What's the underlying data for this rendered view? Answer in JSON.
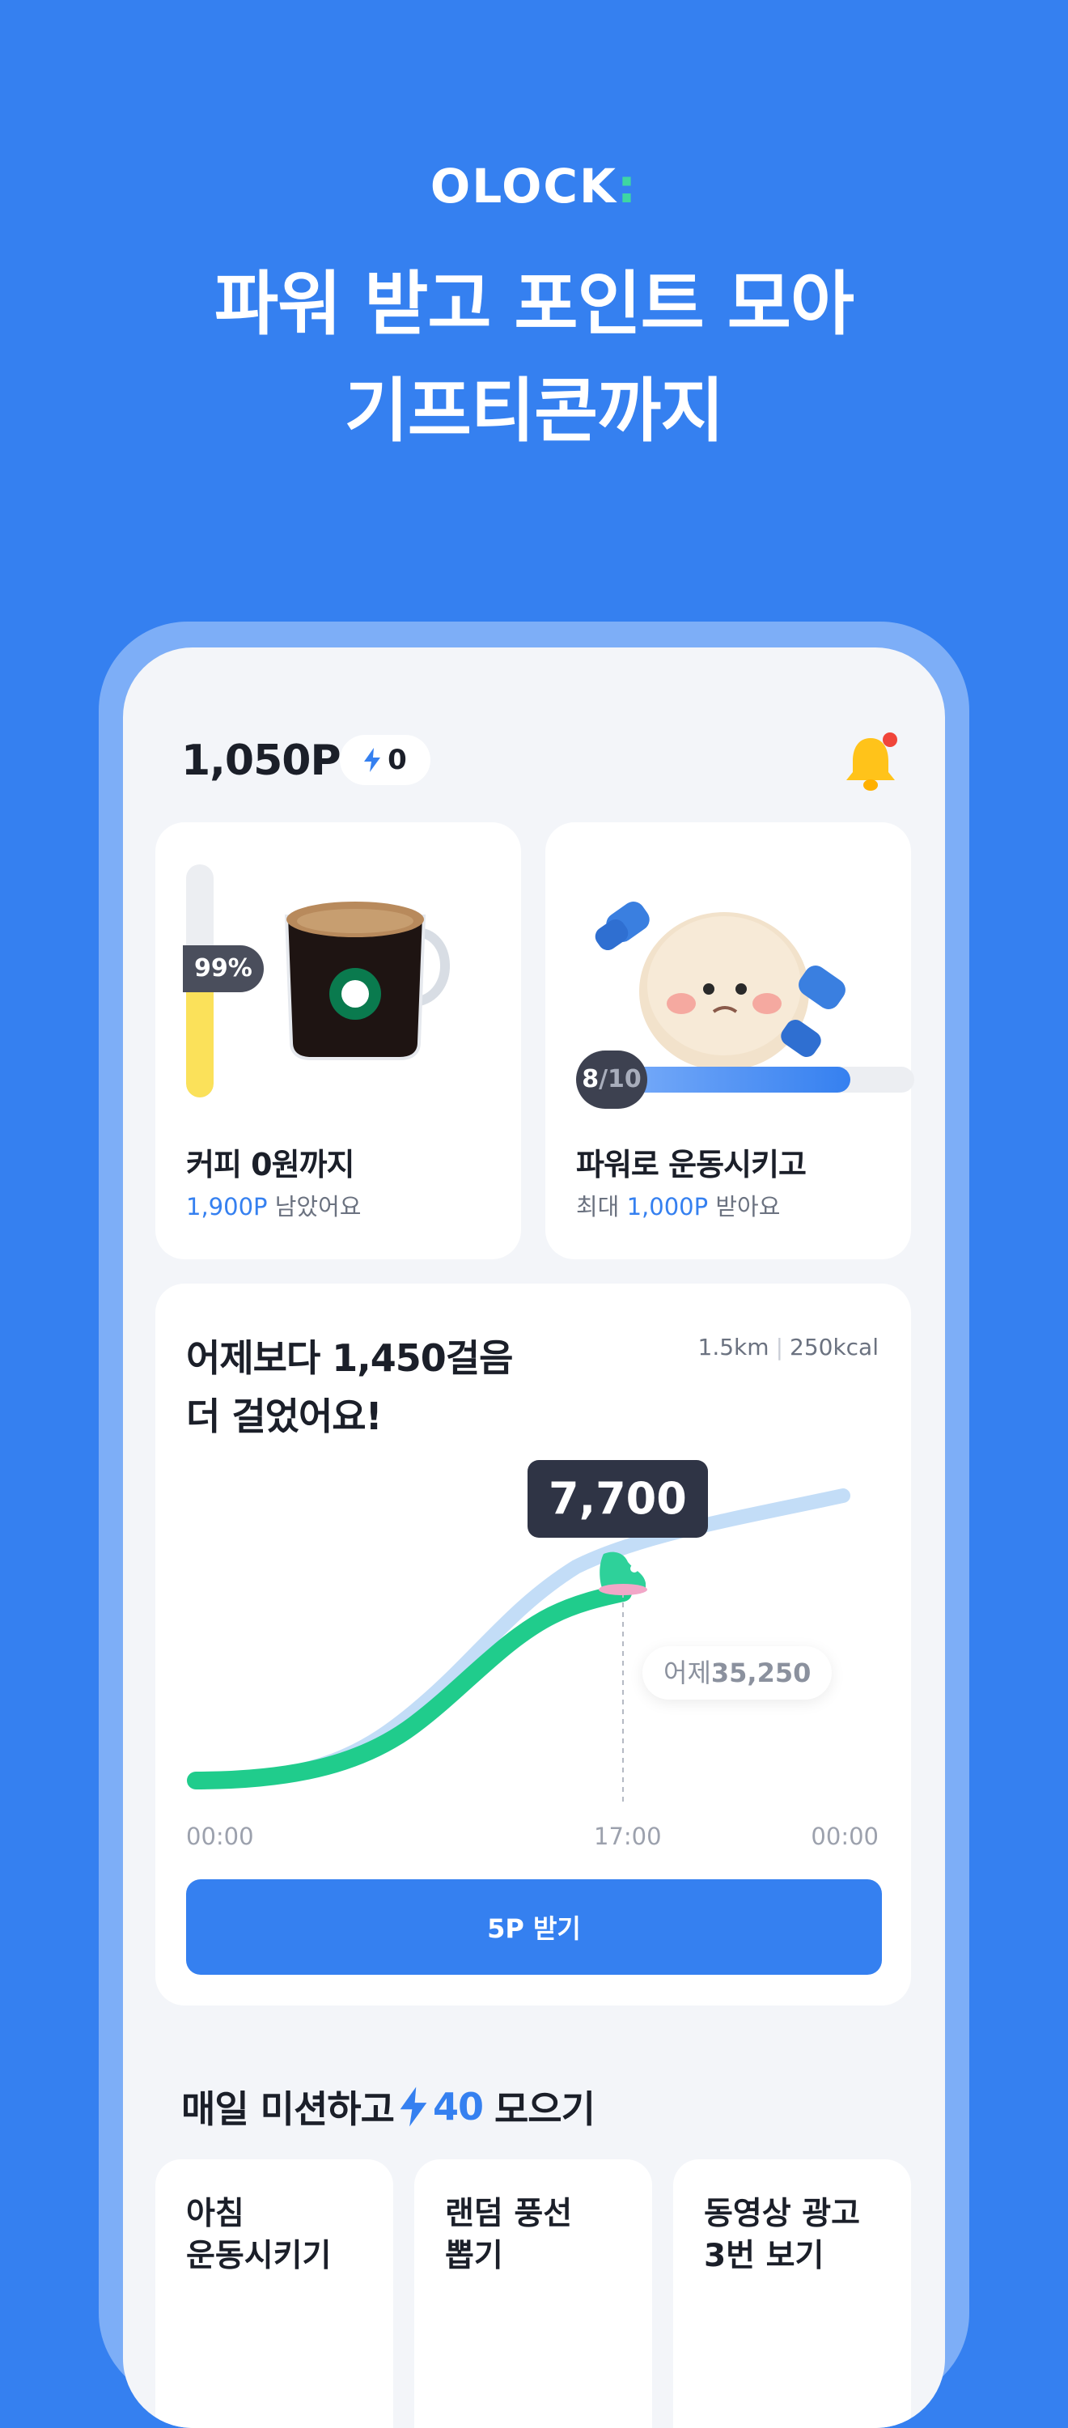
{
  "logo": {
    "text": "OLOCK",
    "mark": ":"
  },
  "headline": {
    "line1": "파워 받고 포인트 모아",
    "line2": "기프티콘까지"
  },
  "header": {
    "points": "1,050P",
    "power_count": "0"
  },
  "coffee_card": {
    "progress_percent": 99,
    "badge": "99%",
    "title": "커피 0원까지",
    "sub_value": "1,900P",
    "sub_rest": " 남았어요"
  },
  "exercise_card": {
    "done": "8",
    "total": "/10",
    "progress_fraction": 0.8,
    "title": "파워로 운동시키고",
    "sub_prefix": "최대 ",
    "sub_value": "1,000P",
    "sub_rest": " 받아요"
  },
  "steps_card": {
    "title_line1": "어제보다 1,450걸음",
    "title_line2": "더 걸었어요!",
    "distance": "1.5km",
    "calories": "250kcal",
    "current_steps": "7,700",
    "yesterday_label": "어제",
    "yesterday_steps": "35,250",
    "x_ticks": [
      "00:00",
      "17:00",
      "00:00"
    ],
    "claim_label": "5P 받기"
  },
  "missions": {
    "heading_prefix": "매일 미션하고",
    "heading_count": "40",
    "heading_suffix": "모으기",
    "items": [
      {
        "line1": "아침",
        "line2": "운동시키기"
      },
      {
        "line1": "랜덤 풍선",
        "line2": "뽑기"
      },
      {
        "line1": "동영상 광고",
        "line2": "3번 보기"
      }
    ]
  },
  "colors": {
    "brand_blue": "#3580F0",
    "accent_green": "#20CC8C",
    "progress_yellow": "#FBE15A"
  }
}
